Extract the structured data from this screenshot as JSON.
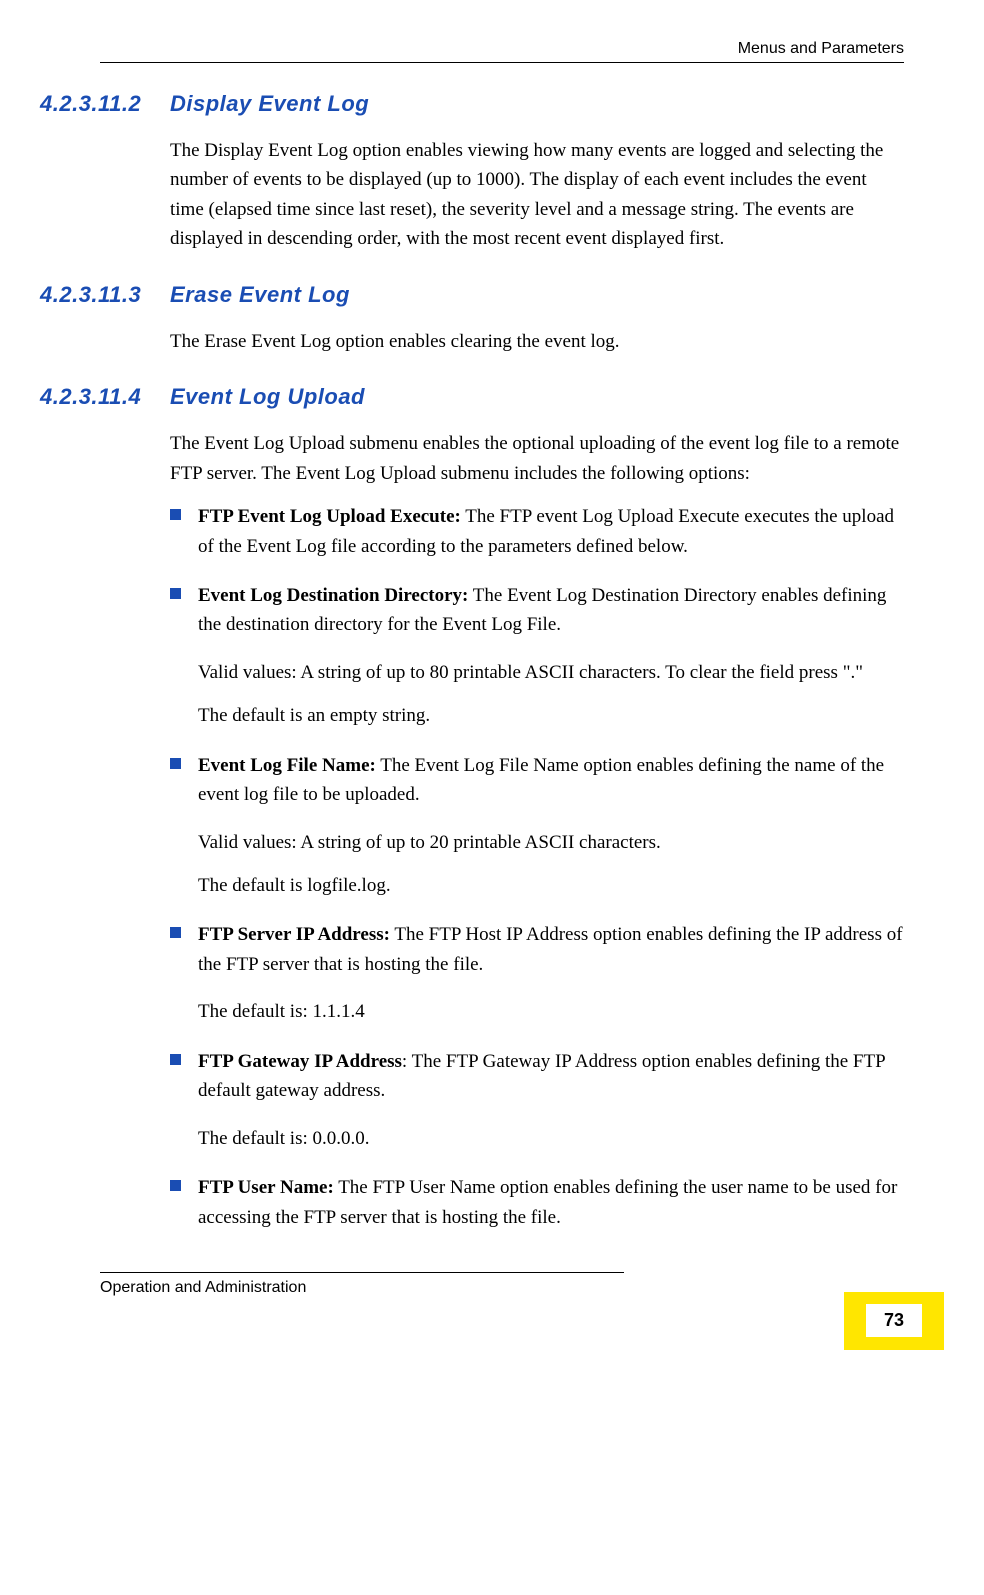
{
  "header": {
    "chapter": "Menus and Parameters"
  },
  "sections": [
    {
      "number": "4.2.3.11.2",
      "title": "Display Event Log",
      "body": "The Display Event Log option enables viewing how many events are logged and selecting the number of events to be displayed (up to 1000). The display of each event includes the event time (elapsed time since last reset), the severity level and a message string. The events are displayed in descending order, with the most recent event displayed first."
    },
    {
      "number": "4.2.3.11.3",
      "title": "Erase Event Log",
      "body": "The Erase Event Log option enables clearing the event log."
    },
    {
      "number": "4.2.3.11.4",
      "title": "Event Log Upload",
      "body": "The Event Log Upload submenu enables the optional uploading of the event log file to a remote FTP server. The Event Log Upload submenu includes the following options:"
    }
  ],
  "bullets": [
    {
      "label": "FTP Event Log Upload Execute:",
      "lead": " The FTP event Log Upload Execute executes the upload of the Event Log file according to the parameters defined below.",
      "paras": []
    },
    {
      "label": "Event Log Destination Directory:",
      "lead": " The Event Log Destination Directory enables defining the destination directory for the Event Log File.",
      "paras": [
        "Valid values: A string of up to 80 printable ASCII characters. To clear the field press \".\"",
        "The default is an empty string."
      ]
    },
    {
      "label": "Event Log File Name:",
      "lead": " The Event Log File Name option enables defining the name of the event log file to be uploaded.",
      "paras": [
        "Valid values: A string of up to 20 printable ASCII characters.",
        "The default is logfile.log."
      ]
    },
    {
      "label": "FTP Server IP Address:",
      "lead": " The FTP Host IP Address option enables defining the IP address of the FTP server that is hosting the file.",
      "paras": [
        "The default is: 1.1.1.4"
      ]
    },
    {
      "label": "FTP Gateway IP Address",
      "lead": ": The FTP Gateway IP Address option enables defining the FTP default gateway address.",
      "paras": [
        "The default is: 0.0.0.0."
      ]
    },
    {
      "label": "FTP User Name:",
      "lead": " The FTP User Name option enables defining the user name to be used for accessing the FTP server that is hosting the file.",
      "paras": []
    }
  ],
  "footer": {
    "label": "Operation and Administration",
    "page": "73"
  }
}
